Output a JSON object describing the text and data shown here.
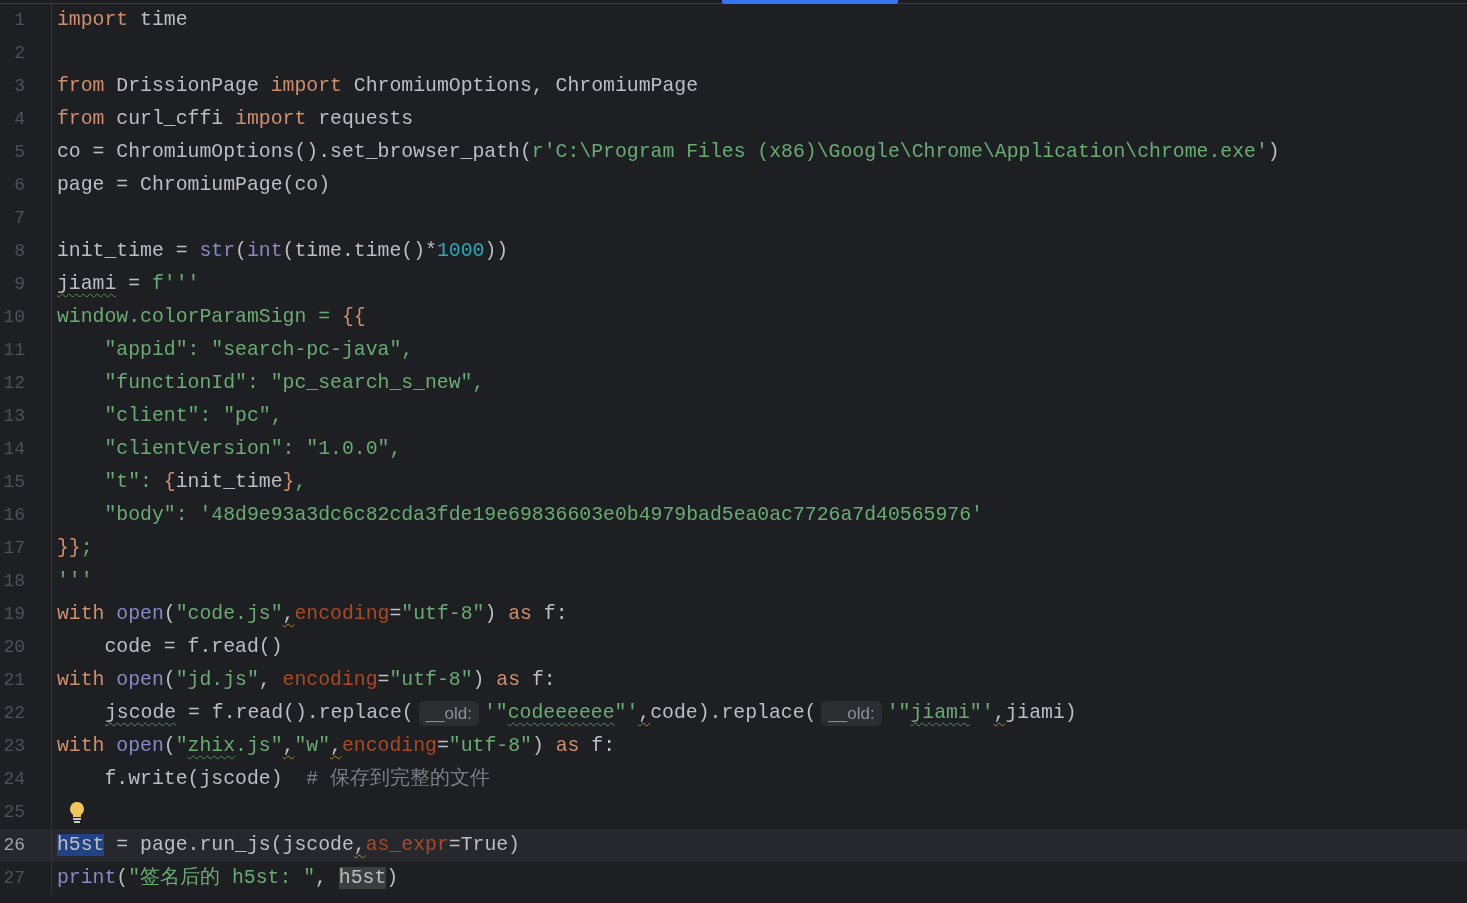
{
  "editor": {
    "lines": [
      {
        "number": "1",
        "current": false,
        "tokens": [
          {
            "t": "import",
            "kind": "keyword"
          },
          {
            "t": " time",
            "kind": "plain"
          }
        ]
      },
      {
        "number": "2",
        "current": false
      },
      {
        "number": "3",
        "current": false,
        "tokens": [
          {
            "t": "from",
            "kind": "keyword"
          },
          {
            "t": " DrissionPage ",
            "kind": "plain"
          },
          {
            "t": "import",
            "kind": "keyword"
          },
          {
            "t": " ChromiumOptions, ChromiumPage",
            "kind": "plain"
          }
        ]
      },
      {
        "number": "4",
        "current": false,
        "tokens": [
          {
            "t": "from",
            "kind": "keyword"
          },
          {
            "t": " curl_cffi ",
            "kind": "plain"
          },
          {
            "t": "import",
            "kind": "keyword"
          },
          {
            "t": " requests",
            "kind": "plain"
          }
        ]
      },
      {
        "number": "5",
        "current": false,
        "tokens": [
          {
            "t": "co = ChromiumOptions().set_browser_path(",
            "kind": "plain"
          },
          {
            "t": "r'C:\\Program Files (x86)\\Google\\Chrome\\Application\\chrome.exe'",
            "kind": "string"
          },
          {
            "t": ")",
            "kind": "plain"
          }
        ]
      },
      {
        "number": "6",
        "current": false,
        "tokens": [
          {
            "t": "page = ChromiumPage(co)",
            "kind": "plain"
          }
        ]
      },
      {
        "number": "7",
        "current": false
      },
      {
        "number": "8",
        "current": false,
        "tokens": [
          {
            "t": "init_time = ",
            "kind": "plain"
          },
          {
            "t": "str",
            "kind": "builtin"
          },
          {
            "t": "(",
            "kind": "plain"
          },
          {
            "t": "int",
            "kind": "builtin"
          },
          {
            "t": "(time.time()*",
            "kind": "plain"
          },
          {
            "t": "1000",
            "kind": "number"
          },
          {
            "t": "))",
            "kind": "plain"
          }
        ]
      },
      {
        "number": "9",
        "current": false,
        "tokens": [
          {
            "t": "jiami",
            "kind": "plain",
            "typo": true
          },
          {
            "t": " = ",
            "kind": "plain"
          },
          {
            "t": "f'''",
            "kind": "string"
          }
        ]
      },
      {
        "number": "10",
        "current": false,
        "tokens": [
          {
            "t": "window.colorParamSign = ",
            "kind": "string"
          },
          {
            "t": "{{",
            "kind": "brace"
          }
        ]
      },
      {
        "number": "11",
        "current": false,
        "tokens": [
          {
            "t": "    \"appid\": \"search-pc-java\",",
            "kind": "string"
          }
        ]
      },
      {
        "number": "12",
        "current": false,
        "tokens": [
          {
            "t": "    \"functionId\": \"pc_search_s_new\",",
            "kind": "string"
          }
        ]
      },
      {
        "number": "13",
        "current": false,
        "tokens": [
          {
            "t": "    \"client\": \"pc\",",
            "kind": "string"
          }
        ]
      },
      {
        "number": "14",
        "current": false,
        "tokens": [
          {
            "t": "    \"clientVersion\": \"1.0.0\",",
            "kind": "string"
          }
        ]
      },
      {
        "number": "15",
        "current": false,
        "tokens": [
          {
            "t": "    \"t\": ",
            "kind": "string"
          },
          {
            "t": "{",
            "kind": "brace"
          },
          {
            "t": "init_time",
            "kind": "plain"
          },
          {
            "t": "}",
            "kind": "brace"
          },
          {
            "t": ",",
            "kind": "string"
          }
        ]
      },
      {
        "number": "16",
        "current": false,
        "tokens": [
          {
            "t": "    \"body\": '48d9e93a3dc6c82cda3fde19e69836603e0b4979bad5ea0ac7726a7d40565976'",
            "kind": "string"
          }
        ]
      },
      {
        "number": "17",
        "current": false,
        "tokens": [
          {
            "t": "}}",
            "kind": "brace"
          },
          {
            "t": ";",
            "kind": "string"
          }
        ]
      },
      {
        "number": "18",
        "current": false,
        "tokens": [
          {
            "t": "'''",
            "kind": "string"
          }
        ]
      },
      {
        "number": "19",
        "current": false,
        "tokens": [
          {
            "t": "with ",
            "kind": "keyword"
          },
          {
            "t": "open",
            "kind": "builtin"
          },
          {
            "t": "(",
            "kind": "plain"
          },
          {
            "t": "\"code.js\"",
            "kind": "string"
          },
          {
            "t": ",",
            "kind": "plain",
            "warn": true
          },
          {
            "t": "encoding",
            "kind": "kwarg"
          },
          {
            "t": "=",
            "kind": "plain"
          },
          {
            "t": "\"utf-8\"",
            "kind": "string"
          },
          {
            "t": ") ",
            "kind": "plain"
          },
          {
            "t": "as",
            "kind": "keyword"
          },
          {
            "t": " f:",
            "kind": "plain"
          }
        ]
      },
      {
        "number": "20",
        "current": false,
        "tokens": [
          {
            "t": "    code = f.read()",
            "kind": "plain"
          }
        ]
      },
      {
        "number": "21",
        "current": false,
        "tokens": [
          {
            "t": "with ",
            "kind": "keyword"
          },
          {
            "t": "open",
            "kind": "builtin"
          },
          {
            "t": "(",
            "kind": "plain"
          },
          {
            "t": "\"jd.js\"",
            "kind": "string"
          },
          {
            "t": ", ",
            "kind": "plain"
          },
          {
            "t": "encoding",
            "kind": "kwarg"
          },
          {
            "t": "=",
            "kind": "plain"
          },
          {
            "t": "\"utf-8\"",
            "kind": "string"
          },
          {
            "t": ") ",
            "kind": "plain"
          },
          {
            "t": "as",
            "kind": "keyword"
          },
          {
            "t": " f:",
            "kind": "plain"
          }
        ]
      },
      {
        "number": "22",
        "current": false,
        "indented": true,
        "tokens": [
          {
            "t": "jscode",
            "kind": "plain",
            "typo": true
          },
          {
            "t": " = f.read().replace(",
            "kind": "plain"
          },
          {
            "t": "__old:",
            "kind": "hint"
          },
          {
            "t": "'\"",
            "kind": "string"
          },
          {
            "t": "codeeeeee",
            "kind": "string",
            "typo": true
          },
          {
            "t": "\"'",
            "kind": "string"
          },
          {
            "t": ",",
            "kind": "plain",
            "warn": true
          },
          {
            "t": "code).replace(",
            "kind": "plain"
          },
          {
            "t": "__old:",
            "kind": "hint"
          },
          {
            "t": "'\"",
            "kind": "string"
          },
          {
            "t": "jiami",
            "kind": "string",
            "typo": true
          },
          {
            "t": "\"'",
            "kind": "string"
          },
          {
            "t": ",",
            "kind": "plain",
            "warn": true
          },
          {
            "t": "jiami)",
            "kind": "plain"
          }
        ]
      },
      {
        "number": "23",
        "current": false,
        "tokens": [
          {
            "t": "with ",
            "kind": "keyword"
          },
          {
            "t": "open",
            "kind": "builtin"
          },
          {
            "t": "(",
            "kind": "plain"
          },
          {
            "t": "\"",
            "kind": "string"
          },
          {
            "t": "zhix",
            "kind": "string",
            "typo": true
          },
          {
            "t": ".js\"",
            "kind": "string"
          },
          {
            "t": ",",
            "kind": "plain",
            "warn": true
          },
          {
            "t": "\"w\"",
            "kind": "string"
          },
          {
            "t": ",",
            "kind": "plain",
            "warn": true
          },
          {
            "t": "encoding",
            "kind": "kwarg"
          },
          {
            "t": "=",
            "kind": "plain"
          },
          {
            "t": "\"utf-8\"",
            "kind": "string"
          },
          {
            "t": ") ",
            "kind": "plain"
          },
          {
            "t": "as",
            "kind": "keyword"
          },
          {
            "t": " f:",
            "kind": "plain"
          }
        ]
      },
      {
        "number": "24",
        "current": false,
        "tokens": [
          {
            "t": "    f.write(jscode)  ",
            "kind": "plain"
          },
          {
            "t": "# 保存到完整的文件",
            "kind": "comment"
          }
        ]
      },
      {
        "number": "25",
        "current": false,
        "bulb": true
      },
      {
        "number": "26",
        "current": true,
        "tokens": [
          {
            "t": "h5st",
            "kind": "selection"
          },
          {
            "t": " = page.run_js(jscode",
            "kind": "plain"
          },
          {
            "t": ",",
            "kind": "plain",
            "warn": true
          },
          {
            "t": "as_expr",
            "kind": "kwarg"
          },
          {
            "t": "=True)",
            "kind": "plain"
          }
        ]
      },
      {
        "number": "27",
        "current": false,
        "tokens": [
          {
            "t": "print",
            "kind": "builtin"
          },
          {
            "t": "(",
            "kind": "plain"
          },
          {
            "t": "\"签名后的 h5st: \"",
            "kind": "string"
          },
          {
            "t": ", ",
            "kind": "plain"
          },
          {
            "t": "h5st",
            "kind": "occurrence"
          },
          {
            "t": ")",
            "kind": "plain"
          }
        ]
      }
    ]
  }
}
